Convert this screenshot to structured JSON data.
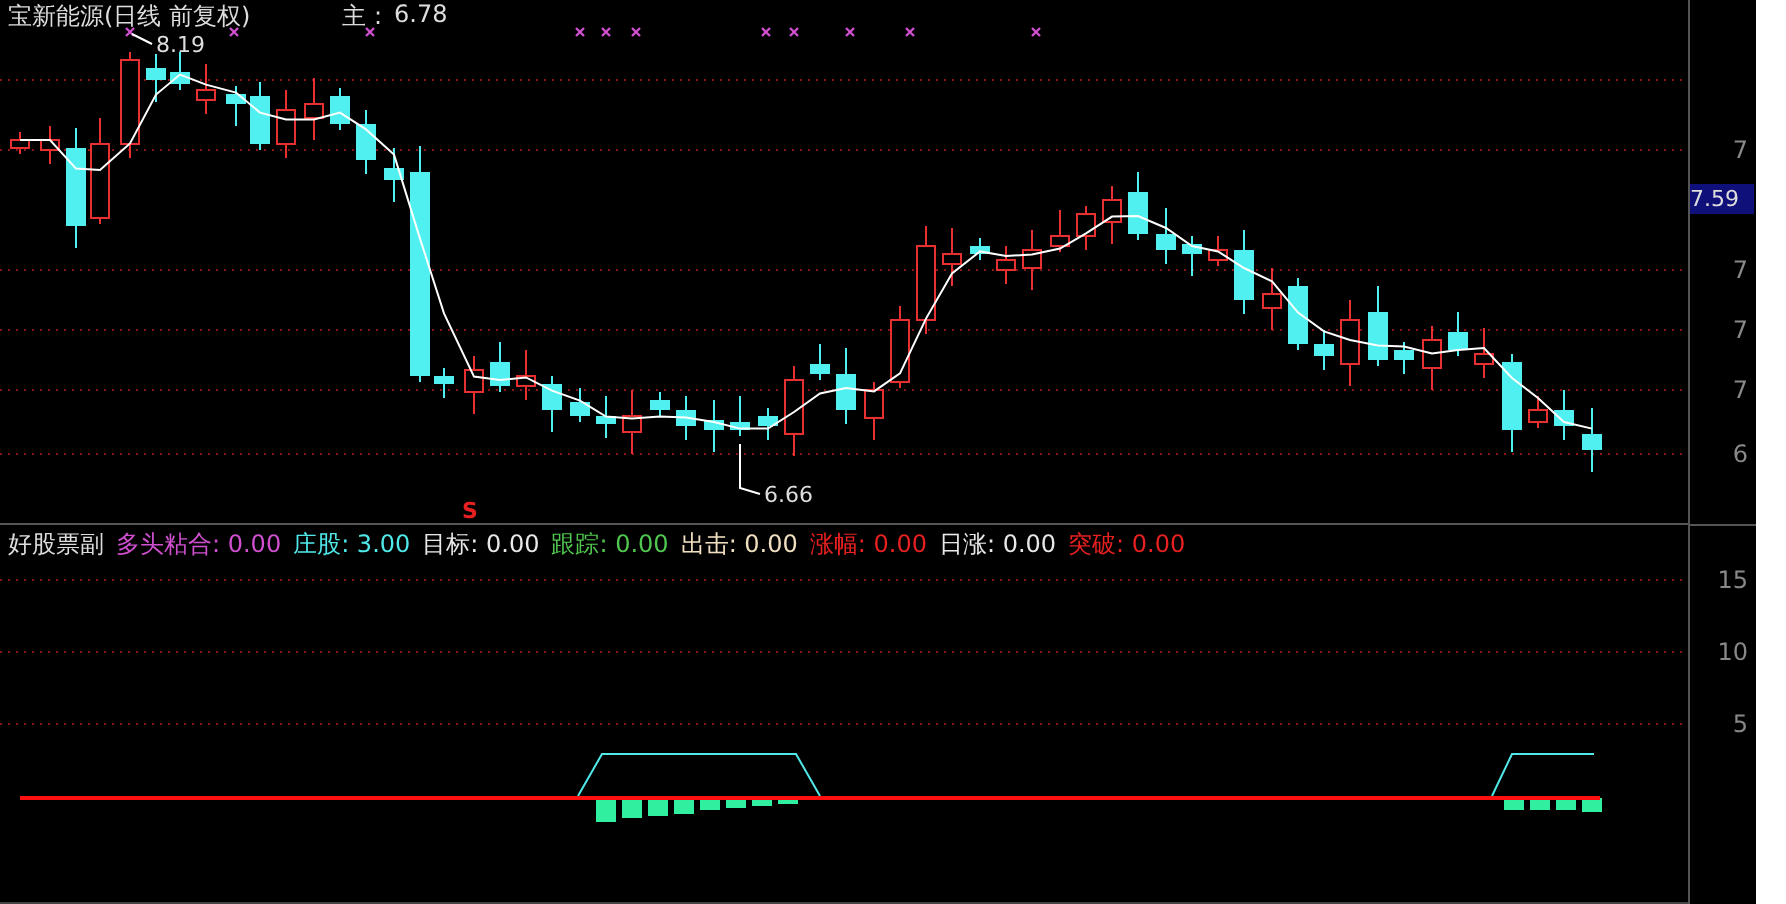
{
  "main_panel": {
    "stock_title": "宝新能源(日线 前复权)",
    "indicator_name": "主 :",
    "indicator_value": "6.78",
    "high_label": "8.19",
    "low_label": "6.66",
    "signal_marker": "S"
  },
  "price_axis": {
    "ticks": [
      "7",
      "7",
      "7",
      "7",
      "6"
    ],
    "current_price": "7.59"
  },
  "sub_panel": {
    "title": "好股票副",
    "legend": [
      {
        "name": "多头粘合:",
        "value": "0.00",
        "color": "#d050d0"
      },
      {
        "name": "庄股:",
        "value": "3.00",
        "color": "#50e8e8"
      },
      {
        "name": "目标:",
        "value": "0.00",
        "color": "#e8e8e8"
      },
      {
        "name": "跟踪:",
        "value": "0.00",
        "color": "#50c850"
      },
      {
        "name": "出击:",
        "value": "0.00",
        "color": "#f0e0c0"
      },
      {
        "name": "涨幅:",
        "value": "0.00",
        "color": "#e82020"
      },
      {
        "name": "日涨:",
        "value": "0.00",
        "color": "#e8e8e8"
      },
      {
        "name": "突破:",
        "value": "0.00",
        "color": "#e82020"
      }
    ],
    "axis_ticks": [
      "15",
      "10",
      "5"
    ]
  }
}
